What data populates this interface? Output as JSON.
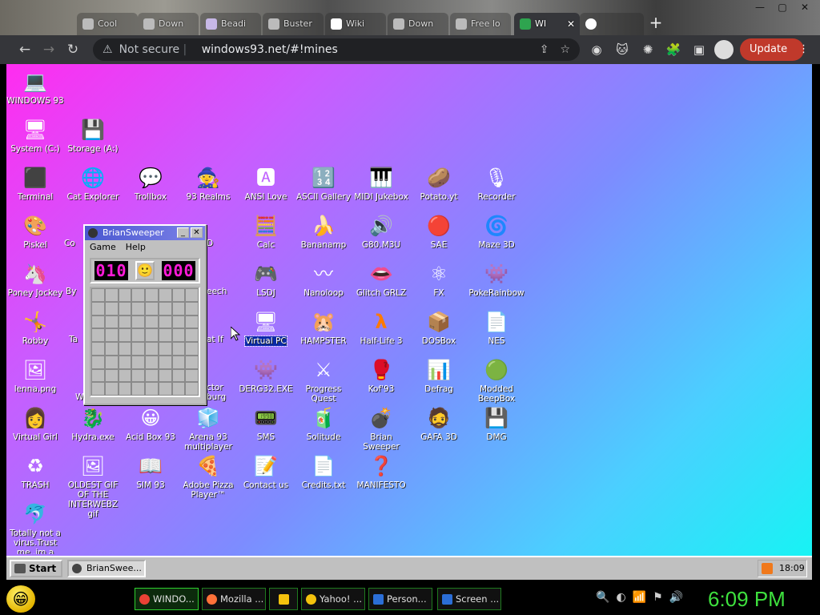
{
  "browser": {
    "tabs": [
      {
        "label": "Cool"
      },
      {
        "label": "Down"
      },
      {
        "label": "Beadi"
      },
      {
        "label": "Buster"
      },
      {
        "label": "Wiki"
      },
      {
        "label": "Down"
      },
      {
        "label": "Free lo"
      },
      {
        "label": "WI"
      }
    ],
    "window_controls": {
      "minimize": "—",
      "restore": "▢",
      "close": "✕"
    },
    "new_tab": "+",
    "security_label": "Not secure",
    "url_host": "windows93.net",
    "url_path": "/#!mines",
    "update_label": "Update"
  },
  "desktop": {
    "icons": [
      {
        "label": "WINDOWS 93",
        "glyph": "💻"
      },
      {
        "label": "System (C:)",
        "glyph": "🖥"
      },
      {
        "label": "Storage (A:)",
        "glyph": "💾"
      },
      {
        "label": "Terminal",
        "glyph": "⬛"
      },
      {
        "label": "Cat Explorer",
        "glyph": "🌐"
      },
      {
        "label": "Trollbox",
        "glyph": "💬"
      },
      {
        "label": "93 Realms",
        "glyph": "🧙"
      },
      {
        "label": "ANSI Love",
        "glyph": "🅰"
      },
      {
        "label": "ASCII Gallery",
        "glyph": "🔢"
      },
      {
        "label": "MIDI Jukebox",
        "glyph": "🎹"
      },
      {
        "label": "Potato.yt",
        "glyph": "🥔"
      },
      {
        "label": "Recorder",
        "glyph": "🎙"
      },
      {
        "label": "Piskel",
        "glyph": "🎨"
      },
      {
        "label": "Calc",
        "glyph": "🧮"
      },
      {
        "label": "Bananamp",
        "glyph": "🍌"
      },
      {
        "label": "G80.M3U",
        "glyph": "🔊"
      },
      {
        "label": "SAE",
        "glyph": "🔴"
      },
      {
        "label": "Maze 3D",
        "glyph": "🌀"
      },
      {
        "label": "Poney Jockey",
        "glyph": "🦄"
      },
      {
        "label": "LSDJ",
        "glyph": "🎮"
      },
      {
        "label": "Nanoloop",
        "glyph": "〰"
      },
      {
        "label": "Glitch GRLZ",
        "glyph": "👄"
      },
      {
        "label": "FX",
        "glyph": "⚛"
      },
      {
        "label": "PokeRainbow",
        "glyph": "👾"
      },
      {
        "label": "Robby",
        "glyph": "🤸"
      },
      {
        "label": "Virtual PC",
        "glyph": "🖥"
      },
      {
        "label": "HAMPSTER",
        "glyph": "🐹"
      },
      {
        "label": "Half-Life 3",
        "glyph": "λ"
      },
      {
        "label": "DOSBox",
        "glyph": "📦"
      },
      {
        "label": "NES",
        "glyph": "📄"
      },
      {
        "label": "lenna.png",
        "glyph": "🖼"
      },
      {
        "label": "DERG32.EXE",
        "glyph": "👾"
      },
      {
        "label": "Progress Quest",
        "glyph": "⚔"
      },
      {
        "label": "Kof'93",
        "glyph": "🥊"
      },
      {
        "label": "Defrag",
        "glyph": "📊"
      },
      {
        "label": "Modded BeepBox",
        "glyph": "🟢"
      },
      {
        "label": "Virtual Girl",
        "glyph": "👩"
      },
      {
        "label": "Hydra.exe",
        "glyph": "🐉"
      },
      {
        "label": "Acid Box 93",
        "glyph": "😀"
      },
      {
        "label": "Arena 93 multiplayer",
        "glyph": "🧊"
      },
      {
        "label": "SMS",
        "glyph": "📟"
      },
      {
        "label": "Solitude",
        "glyph": "🧃"
      },
      {
        "label": "Brian Sweeper",
        "glyph": "💣"
      },
      {
        "label": "GAFA 3D",
        "glyph": "🧔"
      },
      {
        "label": "DMG",
        "glyph": "💾"
      },
      {
        "label": "TRASH",
        "glyph": "♻"
      },
      {
        "label": "OLDEST GIF OF THE INTERWEBZ gif",
        "glyph": "🖼"
      },
      {
        "label": "SIM 93",
        "glyph": "📖"
      },
      {
        "label": "Adobe Pizza Player™",
        "glyph": "🍕"
      },
      {
        "label": "Contact us",
        "glyph": "📝"
      },
      {
        "label": "Credits.txt",
        "glyph": "📄"
      },
      {
        "label": "MANIFESTO",
        "glyph": "❓"
      },
      {
        "label": "Totally not a virus.Trust me..im a",
        "glyph": "🐬"
      }
    ],
    "hidden_partial_labels": [
      "Co",
      "By",
      "Ta",
      "W",
      "D",
      "eech",
      "at If",
      "ctor burg"
    ]
  },
  "sweeper": {
    "title": "BrianSweeper",
    "menu": [
      "Game",
      "Help"
    ],
    "mines_left": "010",
    "timer": "000",
    "face": "🙂",
    "grid_size": 8,
    "minimize": "_",
    "close": "✕"
  },
  "w93_taskbar": {
    "start_label": "Start",
    "task_label": "BrianSwee...",
    "time": "18:09"
  },
  "host_taskbar": {
    "buttons": [
      {
        "label": "WINDO..."
      },
      {
        "label": "Mozilla ..."
      },
      {
        "label": ""
      },
      {
        "label": "Yahoo! ..."
      },
      {
        "label": "Person..."
      },
      {
        "label": "Screen ..."
      }
    ],
    "tray_icons": [
      "🔍",
      "◐",
      "📶",
      "⚑",
      "🔊"
    ],
    "clock": "6:09 PM"
  }
}
